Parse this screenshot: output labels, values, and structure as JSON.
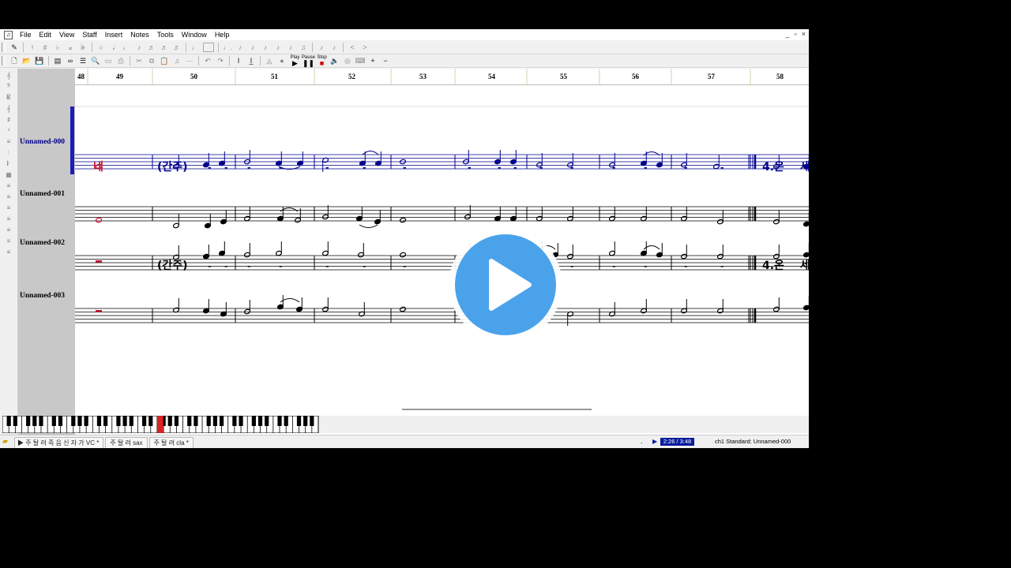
{
  "menu": [
    "File",
    "Edit",
    "View",
    "Staff",
    "Insert",
    "Notes",
    "Tools",
    "Window",
    "Help"
  ],
  "window_controls": [
    "_",
    "▫",
    "×"
  ],
  "toolbar2": {
    "play": "Play",
    "pause": "Pause",
    "stop": "Stop"
  },
  "ruler": {
    "measures": [
      "48",
      "49",
      "50",
      "51",
      "52",
      "53",
      "54",
      "55",
      "56",
      "57",
      "58"
    ]
  },
  "staves": [
    {
      "name": "Unnamed-000",
      "color": "#00008b",
      "selected": true
    },
    {
      "name": "Unnamed-001",
      "color": "#000000",
      "selected": false
    },
    {
      "name": "Unnamed-002",
      "color": "#000000",
      "selected": false
    },
    {
      "name": "Unnamed-003",
      "color": "#000000",
      "selected": false
    }
  ],
  "lyrics_row1": {
    "first": "네",
    "intro": "(간주)",
    "verse": "4.온",
    "cont": "세",
    "dash": "-"
  },
  "lyrics_row2": {
    "intro": "(간주)",
    "verse": "4.온",
    "cont": "세",
    "dash": "-"
  },
  "status": {
    "tabs": [
      "주 탈 려 즉 음 신 자 가 VC *",
      "주 탈 려 sax",
      "주 탈 려 cla *"
    ],
    "dot": ".",
    "time": "2:26 / 3:48",
    "channel": "ch1 Standard: Unnamed-000"
  },
  "colors": {
    "selected_staff": "#00008b",
    "lyric_highlight": "#c8102e",
    "time_badge_bg": "#0a1c9c",
    "play_button": "#4aa3ea"
  }
}
